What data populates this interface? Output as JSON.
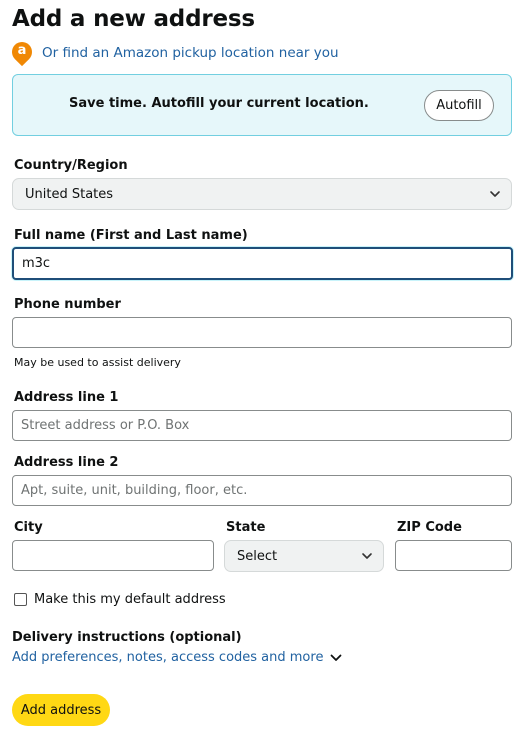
{
  "page_title": "Add a new address",
  "pickup": {
    "icon": "amazon-pin-icon",
    "icon_letter": "a",
    "link_text": "Or find an Amazon pickup location near you"
  },
  "autofill": {
    "message": "Save time. Autofill your current location.",
    "button_label": "Autofill"
  },
  "country": {
    "label": "Country/Region",
    "value": "United States"
  },
  "full_name": {
    "label": "Full name (First and Last name)",
    "value": "m3c"
  },
  "phone": {
    "label": "Phone number",
    "value": "",
    "hint": "May be used to assist delivery"
  },
  "address1": {
    "label": "Address line 1",
    "placeholder": "Street address or P.O. Box"
  },
  "address2": {
    "label": "Address line 2",
    "placeholder": "Apt, suite, unit, building, floor, etc."
  },
  "city": {
    "label": "City",
    "value": ""
  },
  "state": {
    "label": "State",
    "value": "Select"
  },
  "zip": {
    "label": "ZIP Code",
    "value": ""
  },
  "default_address": {
    "label": "Make this my default address",
    "checked": false
  },
  "delivery": {
    "title": "Delivery instructions (optional)",
    "link_text": "Add preferences, notes, access codes and more"
  },
  "submit": {
    "label": "Add address"
  },
  "colors": {
    "link": "#2162a1",
    "primary_button": "#ffd814",
    "autofill_bg": "#e6f7fa",
    "autofill_border": "#72cfe0",
    "pin": "#f08804",
    "focus_border": "#1f4e79"
  }
}
